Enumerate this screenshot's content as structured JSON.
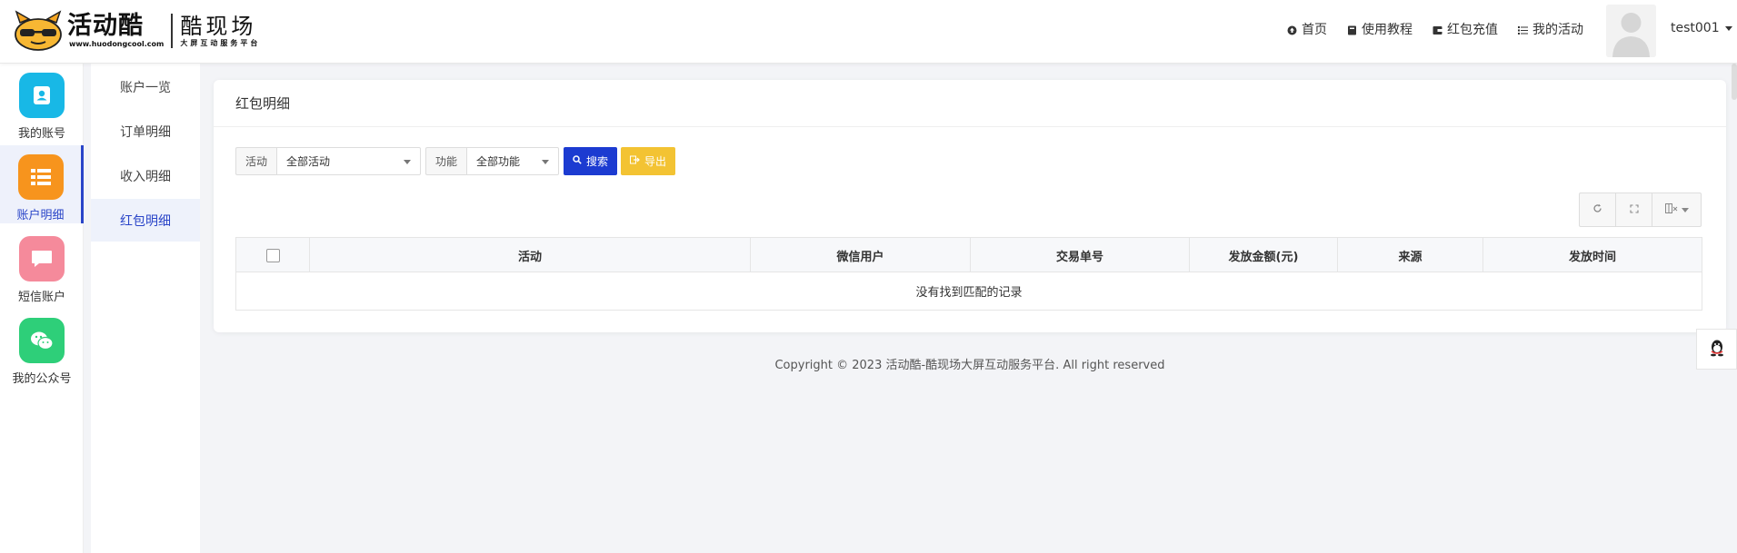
{
  "brand": {
    "name": "活动酷",
    "url": "www.huodongcool.com",
    "product": "酷现场",
    "tagline": "大屏互动服务平台",
    "colors": {
      "primary": "#1c3bd1",
      "accent": "#f3c333"
    }
  },
  "topnav": {
    "items": [
      {
        "label": "首页",
        "icon": "home-icon"
      },
      {
        "label": "使用教程",
        "icon": "book-icon"
      },
      {
        "label": "红包充值",
        "icon": "wallet-icon"
      },
      {
        "label": "我的活动",
        "icon": "list-icon"
      }
    ],
    "username": "test001"
  },
  "sidebar": {
    "items": [
      {
        "label": "我的账号",
        "color": "#18b8e6",
        "icon": "contact-card-icon"
      },
      {
        "label": "账户明细",
        "color": "#f7941d",
        "icon": "table-icon"
      },
      {
        "label": "短信账户",
        "color": "#f58a9b",
        "icon": "message-icon"
      },
      {
        "label": "我的公众号",
        "color": "#2ecf79",
        "icon": "wechat-icon"
      }
    ]
  },
  "subnav": {
    "items": [
      {
        "label": "账户一览"
      },
      {
        "label": "订单明细"
      },
      {
        "label": "收入明细"
      },
      {
        "label": "红包明细"
      }
    ]
  },
  "main": {
    "title": "红包明细",
    "filters": {
      "activity_label": "活动",
      "activity_value": "全部活动",
      "function_label": "功能",
      "function_value": "全部功能",
      "search_label": "搜索",
      "export_label": "导出"
    },
    "table": {
      "columns": [
        "活动",
        "微信用户",
        "交易单号",
        "发放金额(元)",
        "来源",
        "发放时间"
      ],
      "empty_text": "没有找到匹配的记录"
    }
  },
  "footer": {
    "text": "Copyright © 2023 活动酷-酷现场大屏互动服务平台. All right reserved"
  }
}
